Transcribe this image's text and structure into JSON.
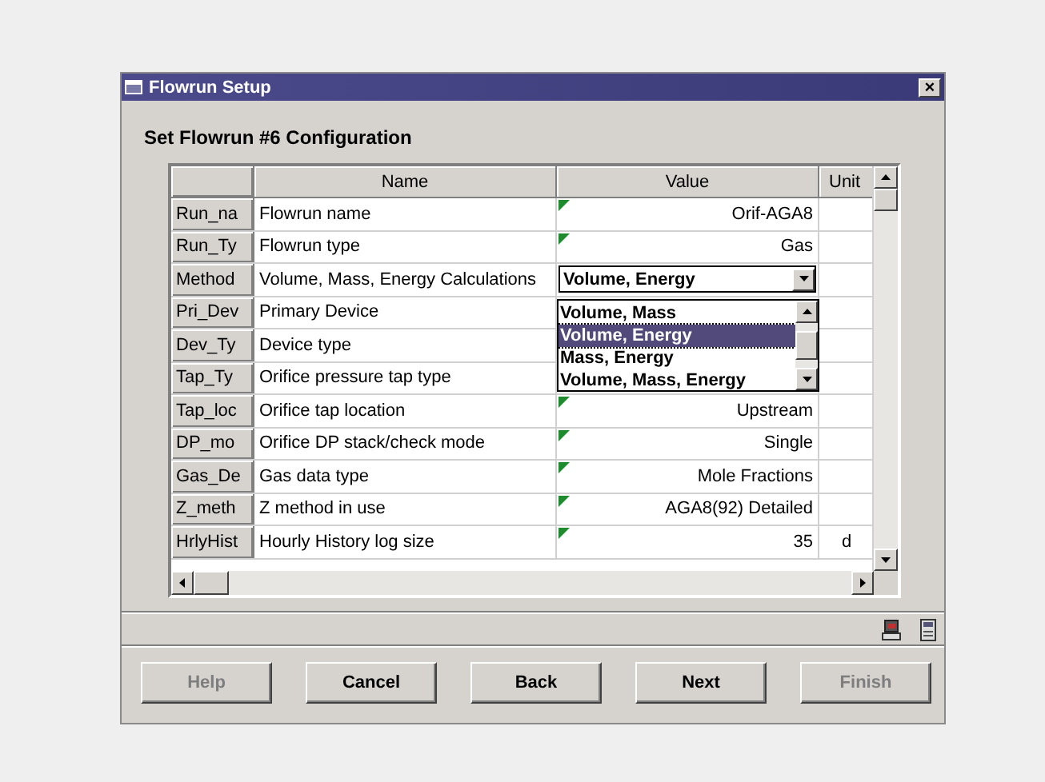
{
  "window": {
    "title": "Flowrun Setup",
    "close": "×"
  },
  "heading": "Set Flowrun #6 Configuration",
  "table": {
    "columns": [
      "Name",
      "Value",
      "Unit"
    ],
    "rows": [
      {
        "header": "Run_na",
        "name": "Flowrun name",
        "value": "Orif-AGA8",
        "unit": "",
        "marked": true,
        "kind": "text"
      },
      {
        "header": "Run_Ty",
        "name": "Flowrun type",
        "value": "Gas",
        "unit": "",
        "marked": true,
        "kind": "text"
      },
      {
        "header": "Method",
        "name": "Volume, Mass, Energy Calculations",
        "value": "Volume, Energy",
        "unit": "",
        "marked": false,
        "kind": "combo"
      },
      {
        "header": "Pri_Dev",
        "name": "Primary Device",
        "value": "",
        "unit": "",
        "marked": false,
        "kind": "text"
      },
      {
        "header": "Dev_Ty",
        "name": "Device type",
        "value": "",
        "unit": "",
        "marked": false,
        "kind": "text"
      },
      {
        "header": "Tap_Ty",
        "name": "Orifice pressure tap type",
        "value": "",
        "unit": "",
        "marked": false,
        "kind": "text"
      },
      {
        "header": "Tap_loc",
        "name": "Orifice tap location",
        "value": "Upstream",
        "unit": "",
        "marked": true,
        "kind": "text"
      },
      {
        "header": "DP_mo",
        "name": "Orifice DP stack/check mode",
        "value": "Single",
        "unit": "",
        "marked": true,
        "kind": "text"
      },
      {
        "header": "Gas_De",
        "name": "Gas data type",
        "value": "Mole Fractions",
        "unit": "",
        "marked": true,
        "kind": "text"
      },
      {
        "header": "Z_meth",
        "name": "Z method in use",
        "value": "AGA8(92) Detailed",
        "unit": "",
        "marked": true,
        "kind": "text"
      },
      {
        "header": "HrlyHist",
        "name": "Hourly History log size",
        "value": "35",
        "unit": "d",
        "marked": true,
        "kind": "text"
      }
    ]
  },
  "dropdown": {
    "options": [
      {
        "label": "Volume, Mass",
        "selected": false
      },
      {
        "label": "Volume, Energy",
        "selected": true
      },
      {
        "label": "Mass, Energy",
        "selected": false
      },
      {
        "label": "Volume, Mass, Energy",
        "selected": false
      }
    ]
  },
  "buttons": [
    {
      "label": "Help",
      "disabled": true
    },
    {
      "label": "Cancel",
      "disabled": false
    },
    {
      "label": "Back",
      "disabled": false
    },
    {
      "label": "Next",
      "disabled": false
    },
    {
      "label": "Finish",
      "disabled": true
    }
  ]
}
